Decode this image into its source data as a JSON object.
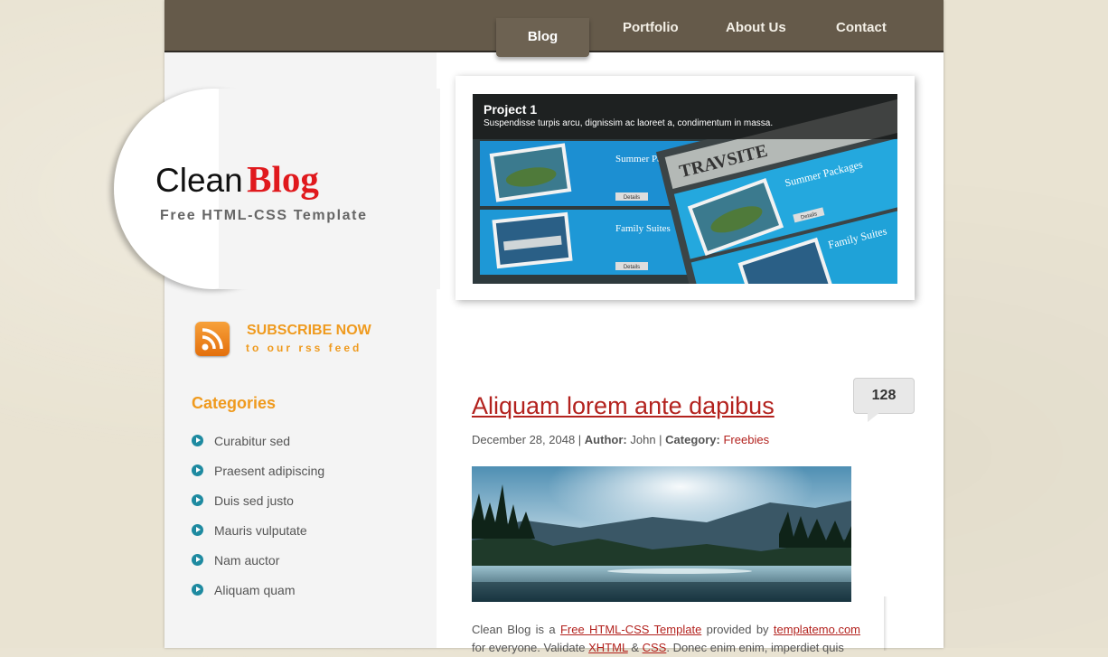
{
  "nav": {
    "items": [
      {
        "label": "Blog",
        "active": true
      },
      {
        "label": "Portfolio"
      },
      {
        "label": "About Us"
      },
      {
        "label": "Contact"
      }
    ]
  },
  "logo": {
    "title_part1": "Clean",
    "title_part2": "Blog",
    "subtitle": "Free HTML-CSS Template"
  },
  "rss": {
    "icon": "rss-feed-icon",
    "title": "SUBSCRIBE NOW",
    "subtitle": "to our rss feed"
  },
  "categories": {
    "heading": "Categories",
    "items": [
      "Curabitur sed",
      "Praesent adipiscing",
      "Duis sed justo",
      "Mauris vulputate",
      "Nam auctor",
      "Aliquam quam"
    ]
  },
  "slider": {
    "title": "Project 1",
    "description": "Suspendisse turpis arcu, dignissim ac laoreet a, condimentum in massa.",
    "screenshot": {
      "brand": "TRAVSITE",
      "panel1": "Summer Packages",
      "panel2": "Family Suites",
      "button": "Details"
    }
  },
  "post": {
    "comment_count": "128",
    "title": "Aliquam lorem ante dapibus",
    "date": "December 28, 2048",
    "sep1": " | ",
    "author_label": "Author:",
    "author": "John",
    "sep2": " | ",
    "category_label": "Category:",
    "category": "Freebies",
    "text_part1": "Clean Blog is a ",
    "link1": "Free HTML-CSS Template",
    "text_part2": " provided by ",
    "link2": "templatemo.com",
    "text_part3": " for everyone. Validate ",
    "link3": "XHTML",
    "text_part4": " & ",
    "link4": "CSS",
    "text_part5": ". Donec enim enim, imperdiet quis"
  },
  "colors": {
    "accent_orange": "#ef9a1e",
    "link_red": "#b3221e",
    "nav_brown": "#655a4a",
    "bullet_teal": "#1e8aa0"
  }
}
